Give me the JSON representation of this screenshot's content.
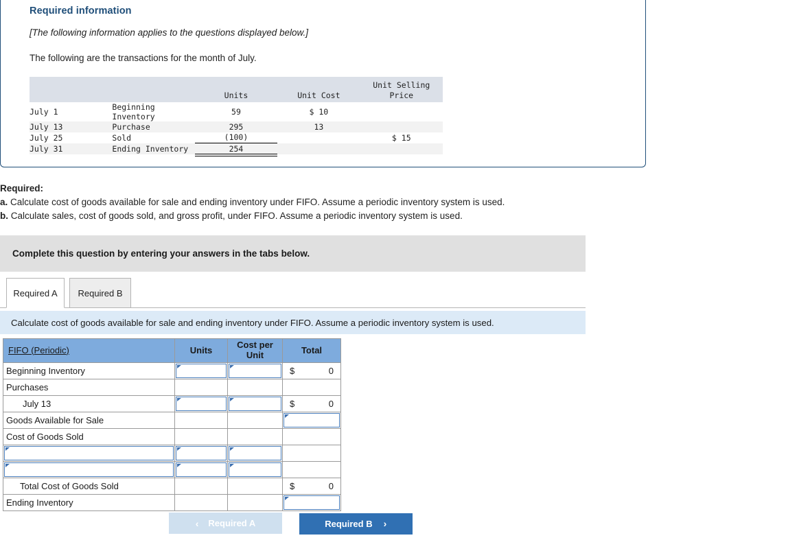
{
  "info_card": {
    "title": "Required information",
    "applies_note": "[The following information applies to the questions displayed below.]",
    "intro": "The following are the transactions for the month of July.",
    "transactions_table": {
      "headers": {
        "date": "",
        "description": "",
        "units": "Units",
        "unit_cost": "Unit Cost",
        "unit_selling_price_line1": "Unit Selling",
        "unit_selling_price_line2": "Price"
      },
      "rows": [
        {
          "date": "July 1",
          "description": "Beginning Inventory",
          "units": "59",
          "unit_cost": "$ 10",
          "unit_selling_price": ""
        },
        {
          "date": "July 13",
          "description": "Purchase",
          "units": "295",
          "unit_cost": "13",
          "unit_selling_price": ""
        },
        {
          "date": "July 25",
          "description": "Sold",
          "units": "(100)",
          "unit_cost": "",
          "unit_selling_price": "$ 15"
        },
        {
          "date": "July 31",
          "description": "Ending Inventory",
          "units": "254",
          "unit_cost": "",
          "unit_selling_price": ""
        }
      ]
    }
  },
  "required": {
    "label": "Required:",
    "items": [
      {
        "letter": "a.",
        "text": "Calculate cost of goods available for sale and ending inventory under FIFO. Assume a periodic inventory system is used."
      },
      {
        "letter": "b.",
        "text": "Calculate sales, cost of goods sold, and gross profit, under FIFO. Assume a periodic inventory system is used."
      }
    ]
  },
  "complete_bar": {
    "text": "Complete this question by entering your answers in the tabs below."
  },
  "tabs": [
    {
      "label": "Required A",
      "active": true
    },
    {
      "label": "Required B",
      "active": false
    }
  ],
  "blue_banner": {
    "text": "Calculate cost of goods available for sale and ending inventory under FIFO. Assume a periodic inventory system is used."
  },
  "fifo_table": {
    "headers": {
      "label": "FIFO (Periodic)",
      "units": "Units",
      "cost_per_unit_line1": "Cost per",
      "cost_per_unit_line2": "Unit",
      "total": "Total"
    },
    "rows": [
      {
        "label": "Beginning Inventory",
        "units_input": true,
        "cpu_input": true,
        "total_kind": "money",
        "dollar": "$",
        "total_value": "0"
      },
      {
        "label": "Purchases",
        "units_input": false,
        "cpu_input": false,
        "total_kind": "blank",
        "dollar": "",
        "total_value": ""
      },
      {
        "label": "July 13",
        "units_input": true,
        "cpu_input": true,
        "total_kind": "money",
        "dollar": "$",
        "total_value": "0",
        "indent": true
      },
      {
        "label": "Goods Available for Sale",
        "units_input": false,
        "cpu_input": false,
        "total_kind": "input",
        "dollar": "",
        "total_value": ""
      },
      {
        "label": "Cost of Goods Sold",
        "units_input": false,
        "cpu_input": false,
        "total_kind": "blank",
        "dollar": "",
        "total_value": ""
      },
      {
        "label": "",
        "units_input": true,
        "cpu_input": true,
        "total_kind": "blank",
        "dollar": "",
        "total_value": "",
        "label_input": true
      },
      {
        "label": "",
        "units_input": true,
        "cpu_input": true,
        "total_kind": "blank",
        "dollar": "",
        "total_value": "",
        "label_input": true
      },
      {
        "label": "Total Cost of Goods Sold",
        "units_input": false,
        "cpu_input": false,
        "total_kind": "money",
        "dollar": "$",
        "total_value": "0",
        "indent": true
      },
      {
        "label": "Ending Inventory",
        "units_input": false,
        "cpu_input": false,
        "total_kind": "input_dbl",
        "dollar": "",
        "total_value": ""
      }
    ]
  },
  "nav": {
    "prev_label": "Required A",
    "next_label": "Required B",
    "prev_chevron": "‹",
    "next_chevron": "›"
  }
}
